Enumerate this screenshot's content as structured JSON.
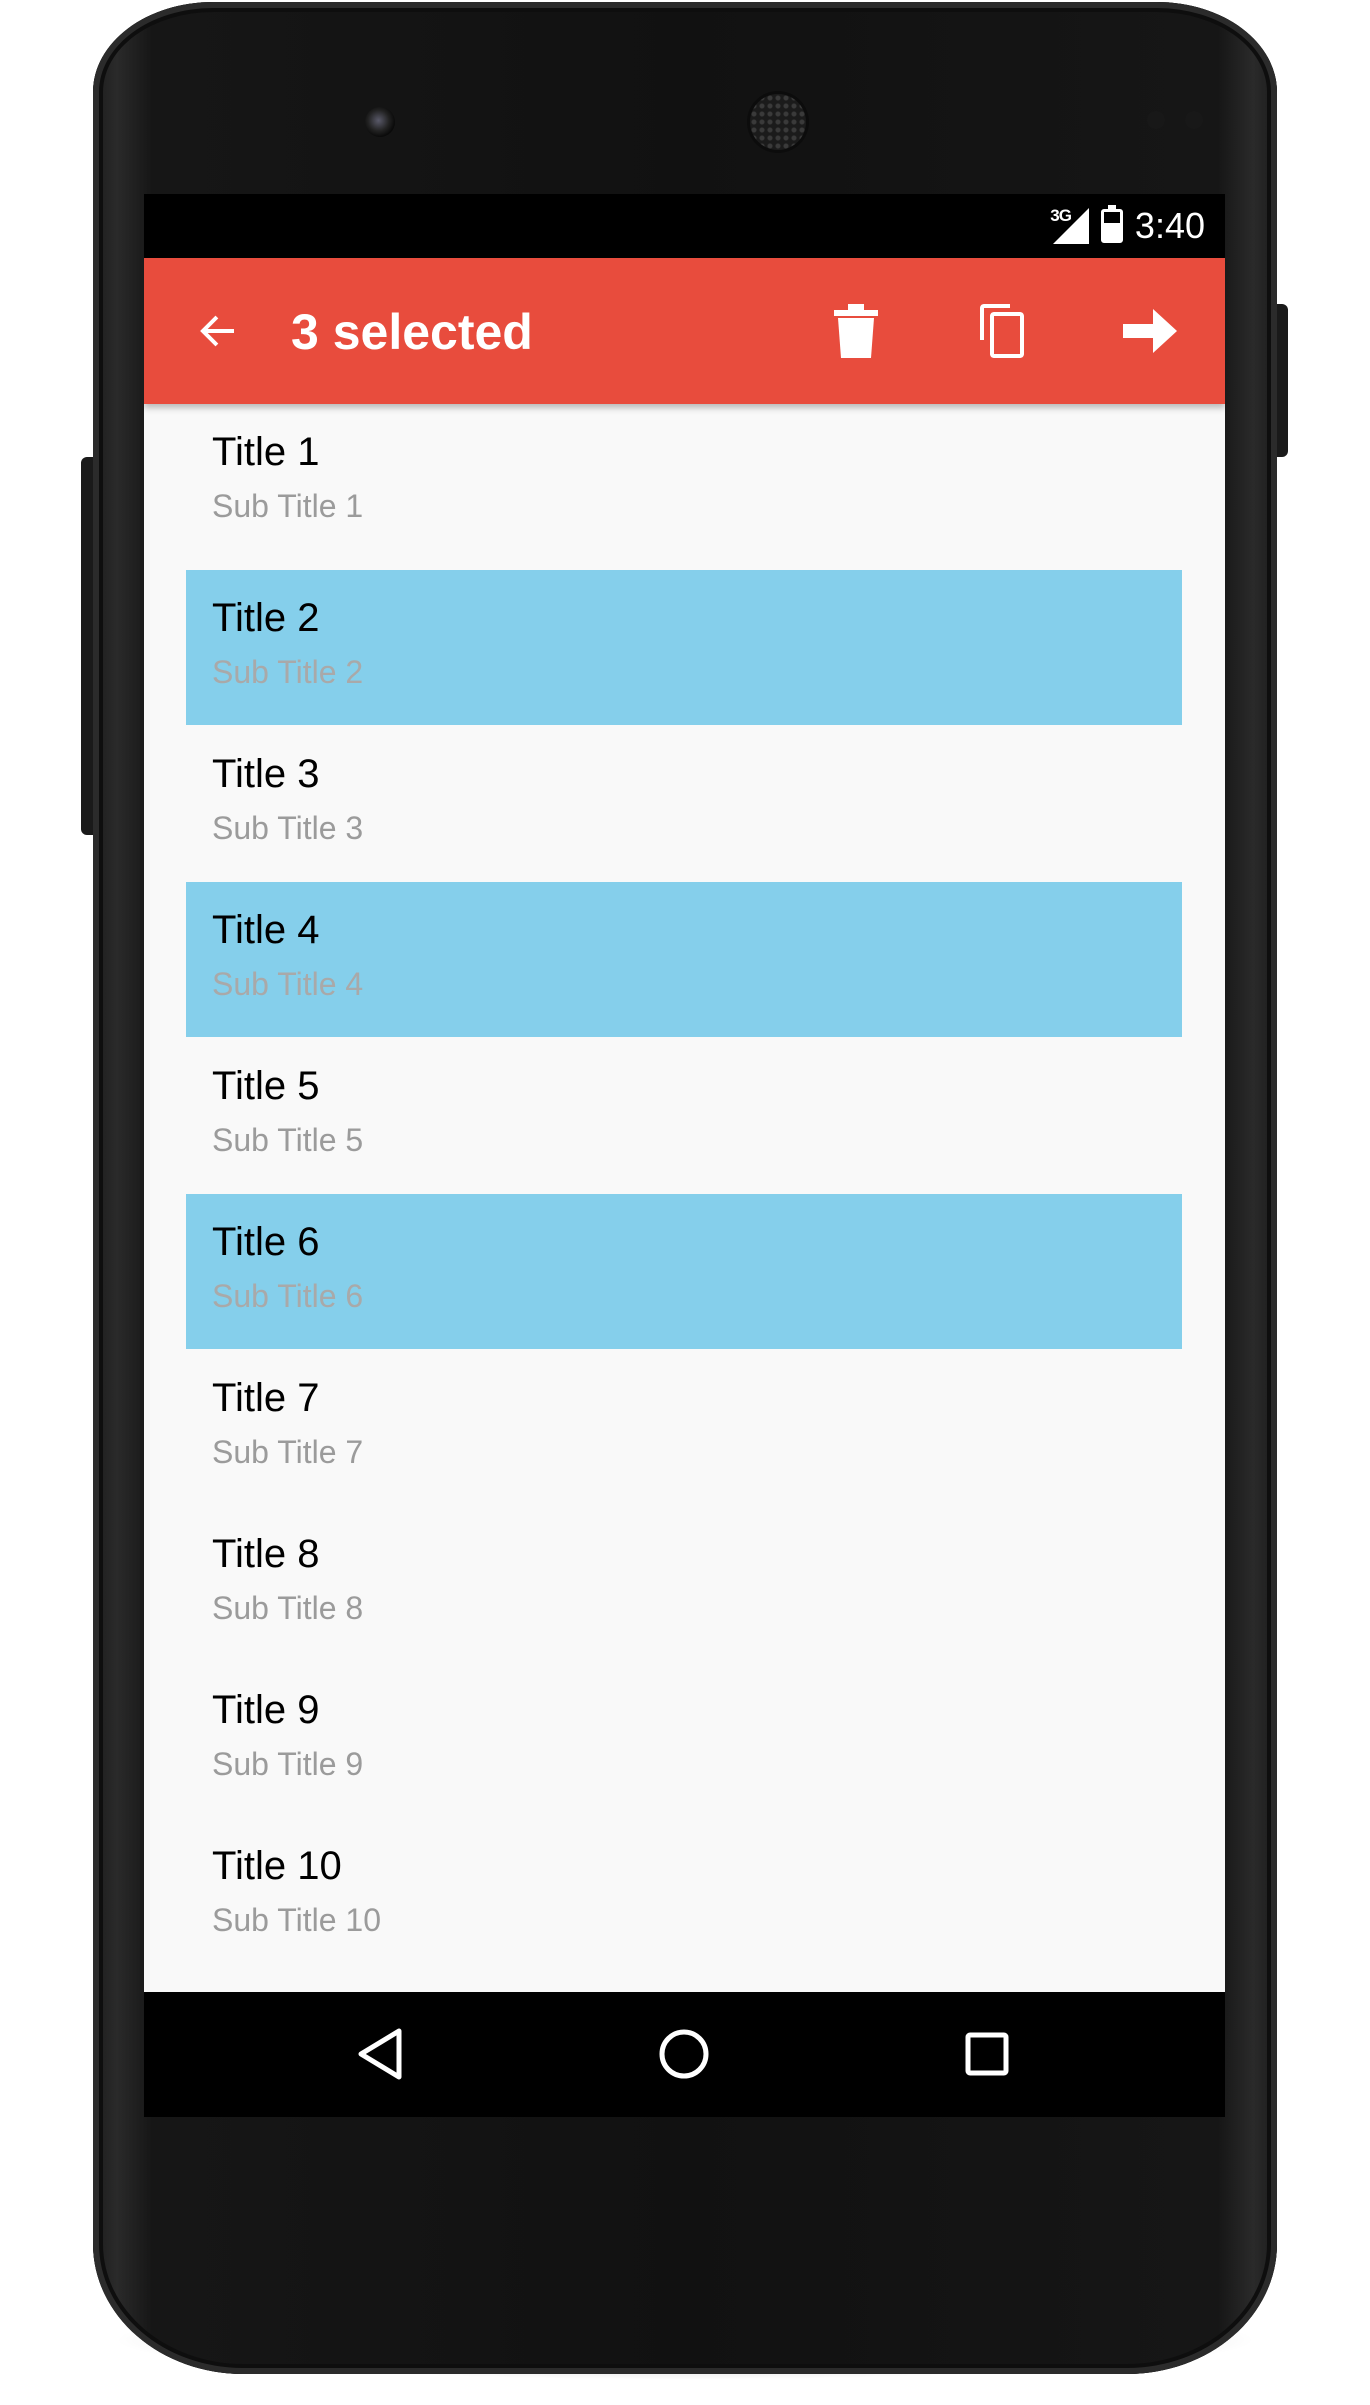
{
  "status_bar": {
    "network": "3G",
    "time": "3:40"
  },
  "app_bar": {
    "title": "3 selected",
    "color": "#e84c3d",
    "back_icon": "arrow-back-icon",
    "actions": [
      {
        "icon": "delete-icon"
      },
      {
        "icon": "copy-icon"
      },
      {
        "icon": "forward-arrow-icon"
      }
    ]
  },
  "list": {
    "selected_color": "#85cfeb",
    "items": [
      {
        "title": "Title 1",
        "subtitle": "Sub Title 1",
        "selected": false
      },
      {
        "title": "Title 2",
        "subtitle": "Sub Title 2",
        "selected": true
      },
      {
        "title": "Title 3",
        "subtitle": "Sub Title 3",
        "selected": false
      },
      {
        "title": "Title 4",
        "subtitle": "Sub Title 4",
        "selected": true
      },
      {
        "title": "Title 5",
        "subtitle": "Sub Title 5",
        "selected": false
      },
      {
        "title": "Title 6",
        "subtitle": "Sub Title 6",
        "selected": true
      },
      {
        "title": "Title 7",
        "subtitle": "Sub Title 7",
        "selected": false
      },
      {
        "title": "Title 8",
        "subtitle": "Sub Title 8",
        "selected": false
      },
      {
        "title": "Title 9",
        "subtitle": "Sub Title 9",
        "selected": false
      },
      {
        "title": "Title 10",
        "subtitle": "Sub Title 10",
        "selected": false
      }
    ]
  },
  "nav_bar": {
    "back_icon": "nav-back-triangle-icon",
    "home_icon": "nav-home-circle-icon",
    "recents_icon": "nav-recents-square-icon"
  }
}
